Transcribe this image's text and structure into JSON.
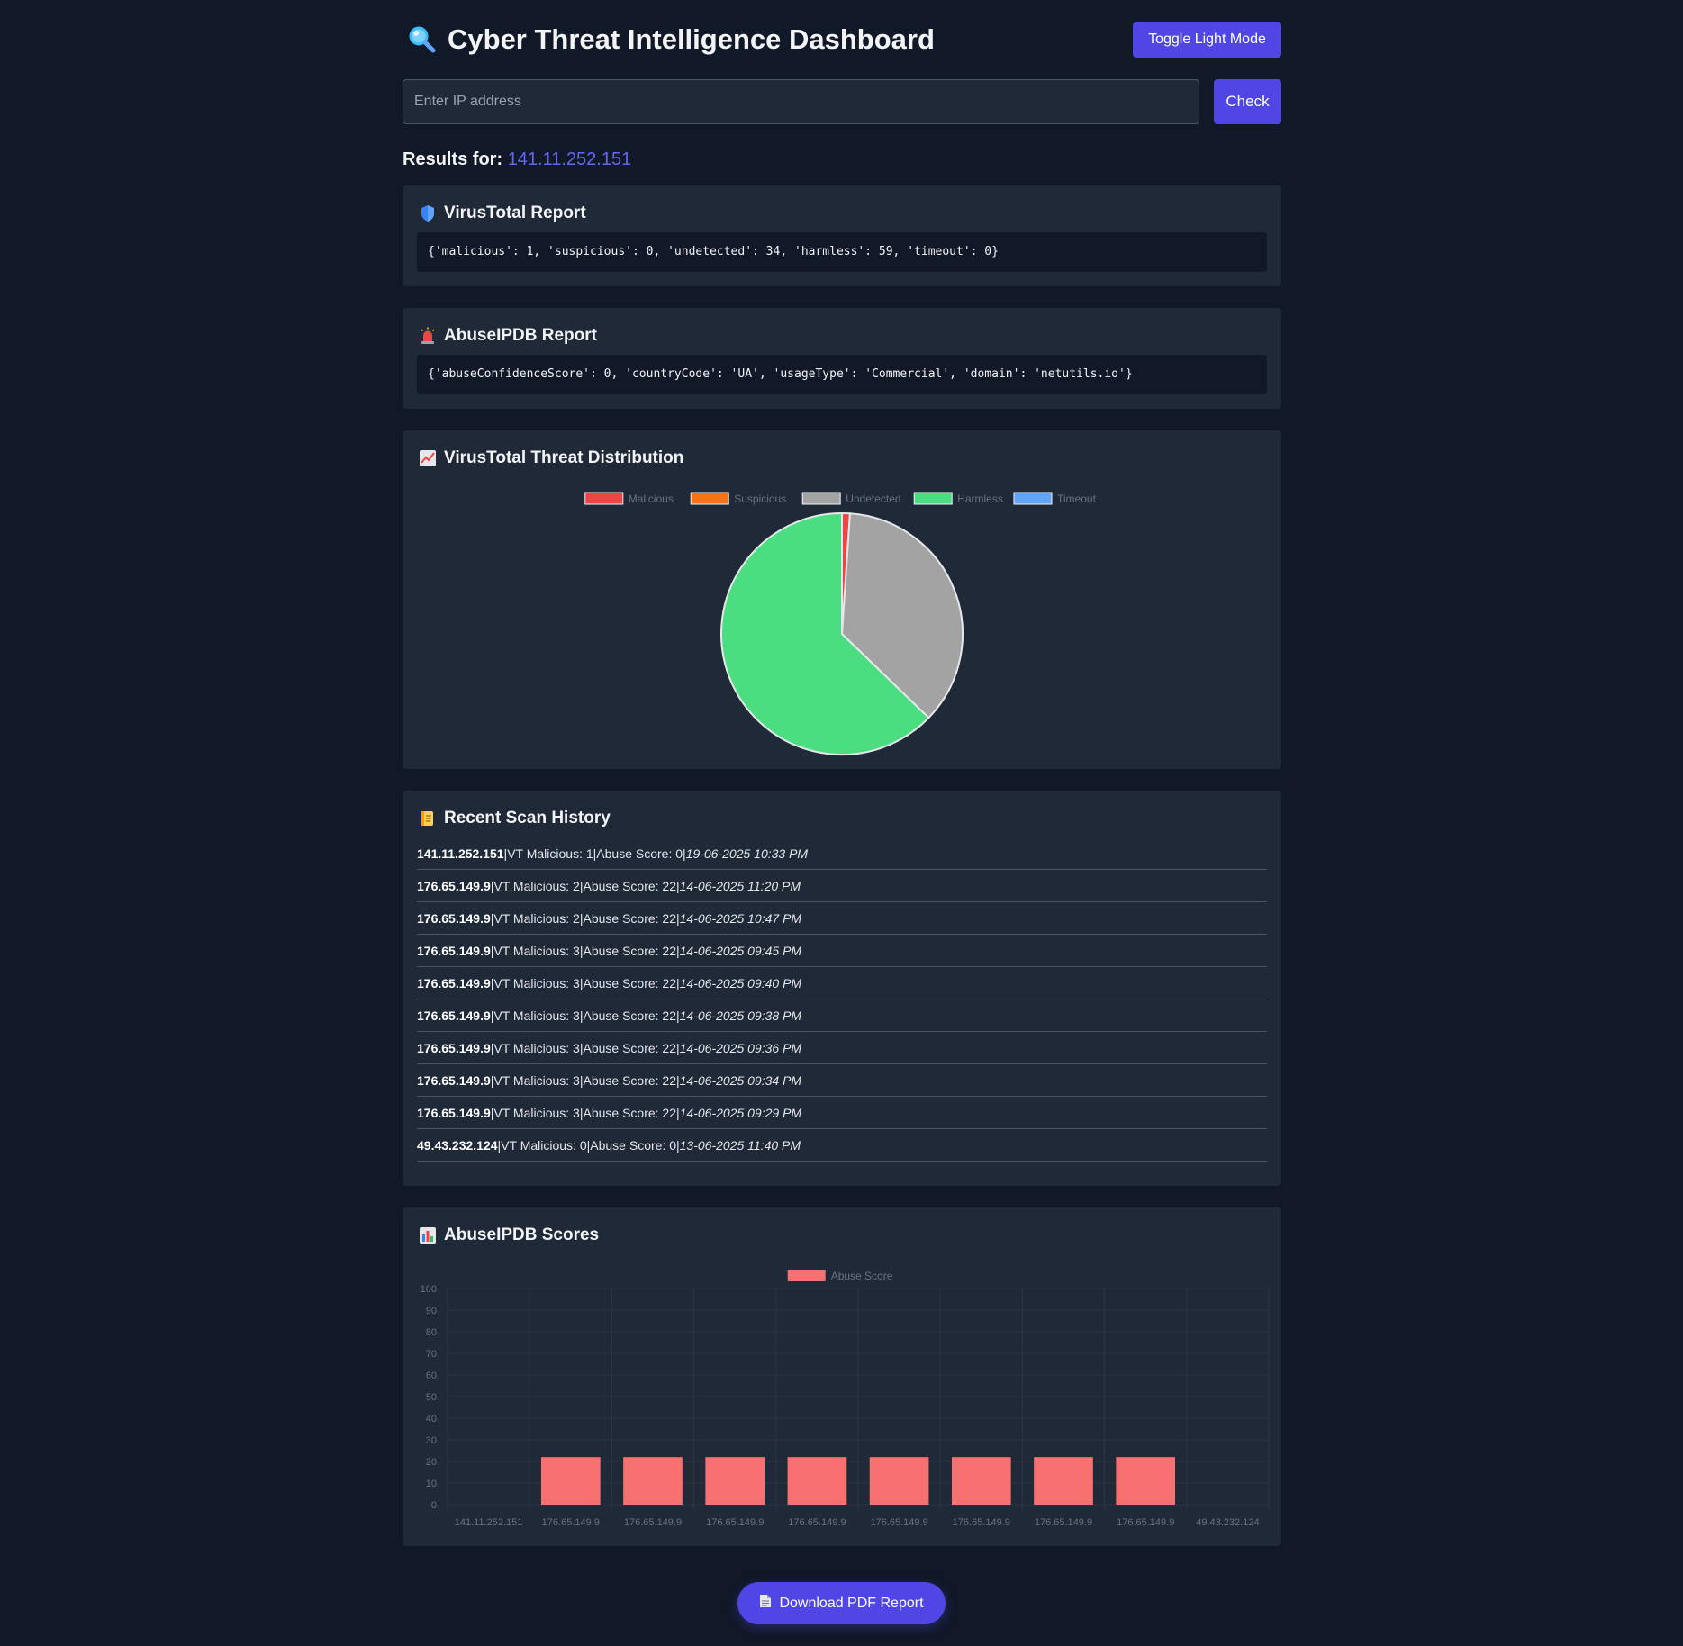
{
  "header": {
    "title": "Cyber Threat Intelligence Dashboard",
    "title_icon": "magnifier-icon",
    "toggle_label": "Toggle Light Mode"
  },
  "search": {
    "placeholder": "Enter IP address",
    "value": "",
    "check_label": "Check"
  },
  "results": {
    "label": "Results for:",
    "ip": "141.11.252.151"
  },
  "virustotal": {
    "icon": "shield-icon",
    "title": "VirusTotal Report",
    "raw": "{'malicious': 1, 'suspicious': 0, 'undetected': 34, 'harmless': 59, 'timeout': 0}"
  },
  "abuseipdb": {
    "icon": "siren-icon",
    "title": "AbuseIPDB Report",
    "raw": "{'abuseConfidenceScore': 0, 'countryCode': 'UA', 'usageType': 'Commercial', 'domain': 'netutils.io'}"
  },
  "distribution": {
    "icon": "chart-line-icon",
    "title": "VirusTotal Threat Distribution"
  },
  "history": {
    "icon": "scroll-icon",
    "title": "Recent Scan History",
    "sep": " | ",
    "items": [
      {
        "ip": "141.11.252.151",
        "vt": "VT Malicious: 1",
        "abuse": "Abuse Score: 0",
        "time": "19-06-2025 10:33 PM"
      },
      {
        "ip": "176.65.149.9",
        "vt": "VT Malicious: 2",
        "abuse": "Abuse Score: 22",
        "time": "14-06-2025 11:20 PM"
      },
      {
        "ip": "176.65.149.9",
        "vt": "VT Malicious: 2",
        "abuse": "Abuse Score: 22",
        "time": "14-06-2025 10:47 PM"
      },
      {
        "ip": "176.65.149.9",
        "vt": "VT Malicious: 3",
        "abuse": "Abuse Score: 22",
        "time": "14-06-2025 09:45 PM"
      },
      {
        "ip": "176.65.149.9",
        "vt": "VT Malicious: 3",
        "abuse": "Abuse Score: 22",
        "time": "14-06-2025 09:40 PM"
      },
      {
        "ip": "176.65.149.9",
        "vt": "VT Malicious: 3",
        "abuse": "Abuse Score: 22",
        "time": "14-06-2025 09:38 PM"
      },
      {
        "ip": "176.65.149.9",
        "vt": "VT Malicious: 3",
        "abuse": "Abuse Score: 22",
        "time": "14-06-2025 09:36 PM"
      },
      {
        "ip": "176.65.149.9",
        "vt": "VT Malicious: 3",
        "abuse": "Abuse Score: 22",
        "time": "14-06-2025 09:34 PM"
      },
      {
        "ip": "176.65.149.9",
        "vt": "VT Malicious: 3",
        "abuse": "Abuse Score: 22",
        "time": "14-06-2025 09:29 PM"
      },
      {
        "ip": "49.43.232.124",
        "vt": "VT Malicious: 0",
        "abuse": "Abuse Score: 0",
        "time": "13-06-2025 11:40 PM"
      }
    ]
  },
  "scores": {
    "icon": "bar-chart-icon",
    "title": "AbuseIPDB Scores"
  },
  "download": {
    "icon": "document-icon",
    "label": "Download PDF Report"
  },
  "colors": {
    "background": "#111827",
    "card": "#1f2937",
    "accent": "#4f46e5",
    "link": "#6366f1"
  },
  "chart_data": [
    {
      "type": "pie",
      "labels": [
        "Malicious",
        "Suspicious",
        "Undetected",
        "Harmless",
        "Timeout"
      ],
      "values": [
        1,
        0,
        34,
        59,
        0
      ],
      "colors": [
        "#ef4444",
        "#f97316",
        "#a3a3a3",
        "#4ade80",
        "#60a5fa"
      ],
      "legend": "top"
    },
    {
      "type": "bar",
      "categories": [
        "141.11.252.151",
        "176.65.149.9",
        "176.65.149.9",
        "176.65.149.9",
        "176.65.149.9",
        "176.65.149.9",
        "176.65.149.9",
        "176.65.149.9",
        "176.65.149.9",
        "49.43.232.124"
      ],
      "series": [
        {
          "name": "Abuse Score",
          "values": [
            0,
            22,
            22,
            22,
            22,
            22,
            22,
            22,
            22,
            0
          ],
          "color": "#f87171"
        }
      ],
      "ylim": [
        0,
        100
      ],
      "yticks": [
        0,
        10,
        20,
        30,
        40,
        50,
        60,
        70,
        80,
        90,
        100
      ],
      "grid": true,
      "legend": "top"
    }
  ]
}
